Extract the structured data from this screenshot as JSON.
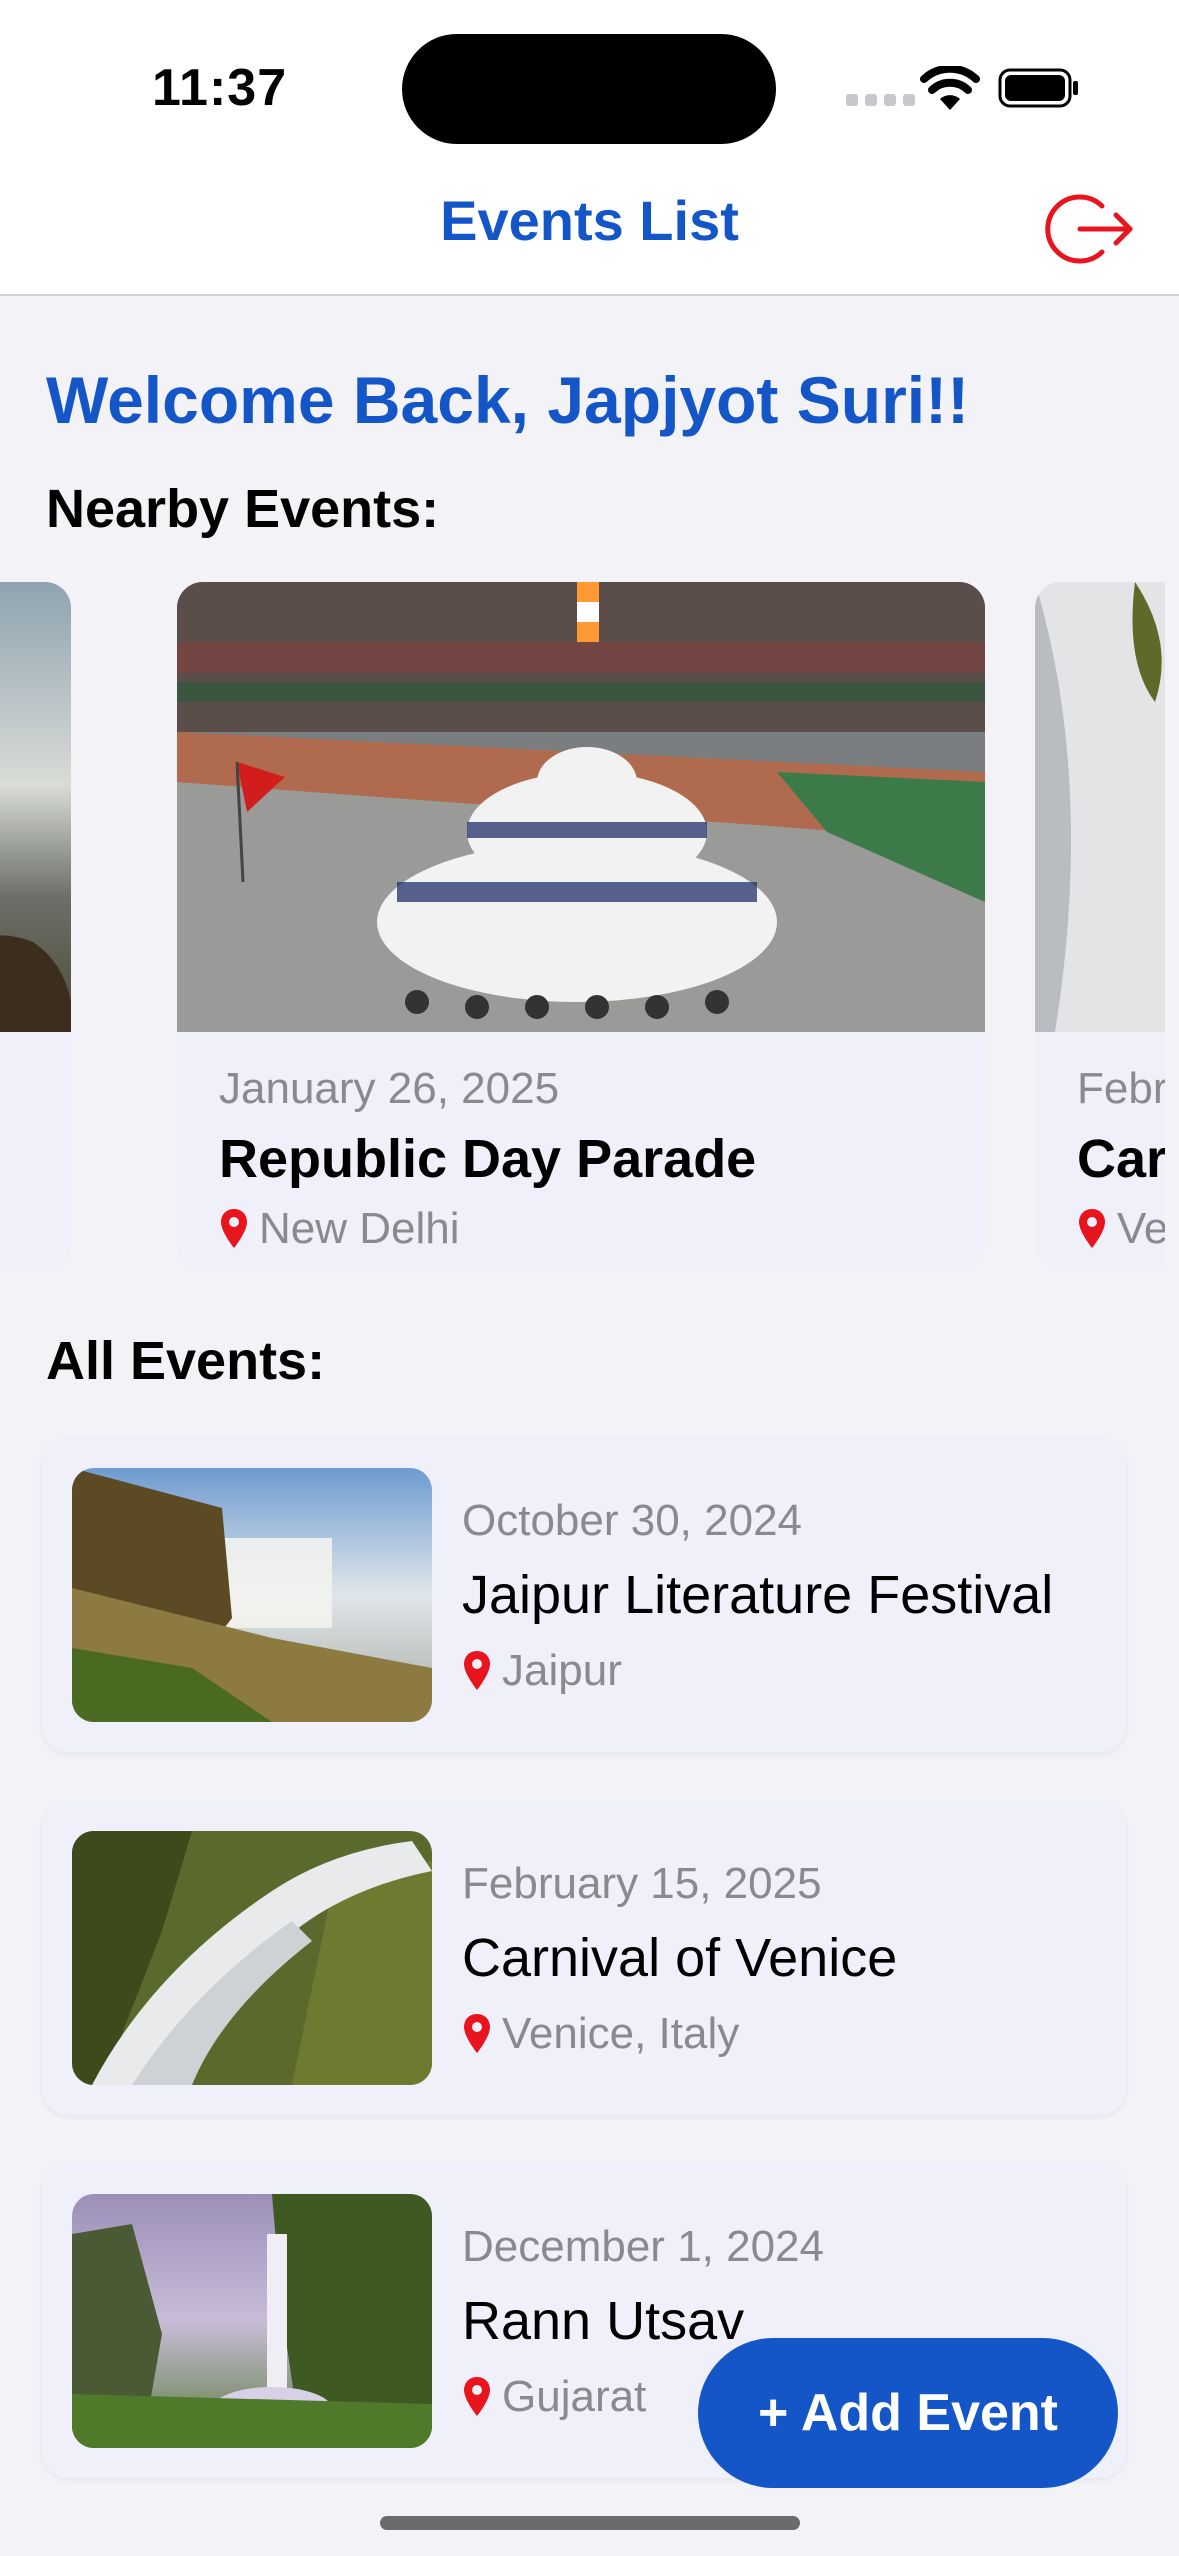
{
  "status_bar": {
    "time": "11:37"
  },
  "nav": {
    "title": "Events List",
    "logout_icon": "logout-icon"
  },
  "welcome": "Welcome Back, Japjyot Suri!!",
  "nearby": {
    "title": "Nearby Events:",
    "cards": [
      {
        "date": "",
        "name": "",
        "location": ""
      },
      {
        "date": "January 26, 2025",
        "name": "Republic Day Parade",
        "location": "New Delhi"
      },
      {
        "date": "Febr",
        "name": "Car",
        "location": "Ve"
      }
    ]
  },
  "all_events": {
    "title": "All Events:",
    "items": [
      {
        "date": "October 30, 2024",
        "name": "Jaipur Literature Festival",
        "location": "Jaipur"
      },
      {
        "date": "February 15, 2025",
        "name": "Carnival of Venice",
        "location": "Venice, Italy"
      },
      {
        "date": "December 1, 2024",
        "name": "Rann Utsav",
        "location": "Gujarat"
      }
    ]
  },
  "add_button": {
    "label": "+ Add Event"
  },
  "colors": {
    "accent": "#1456c8",
    "pin": "#e8141e",
    "background": "#f2f2f7",
    "card": "#f0f0fb"
  }
}
